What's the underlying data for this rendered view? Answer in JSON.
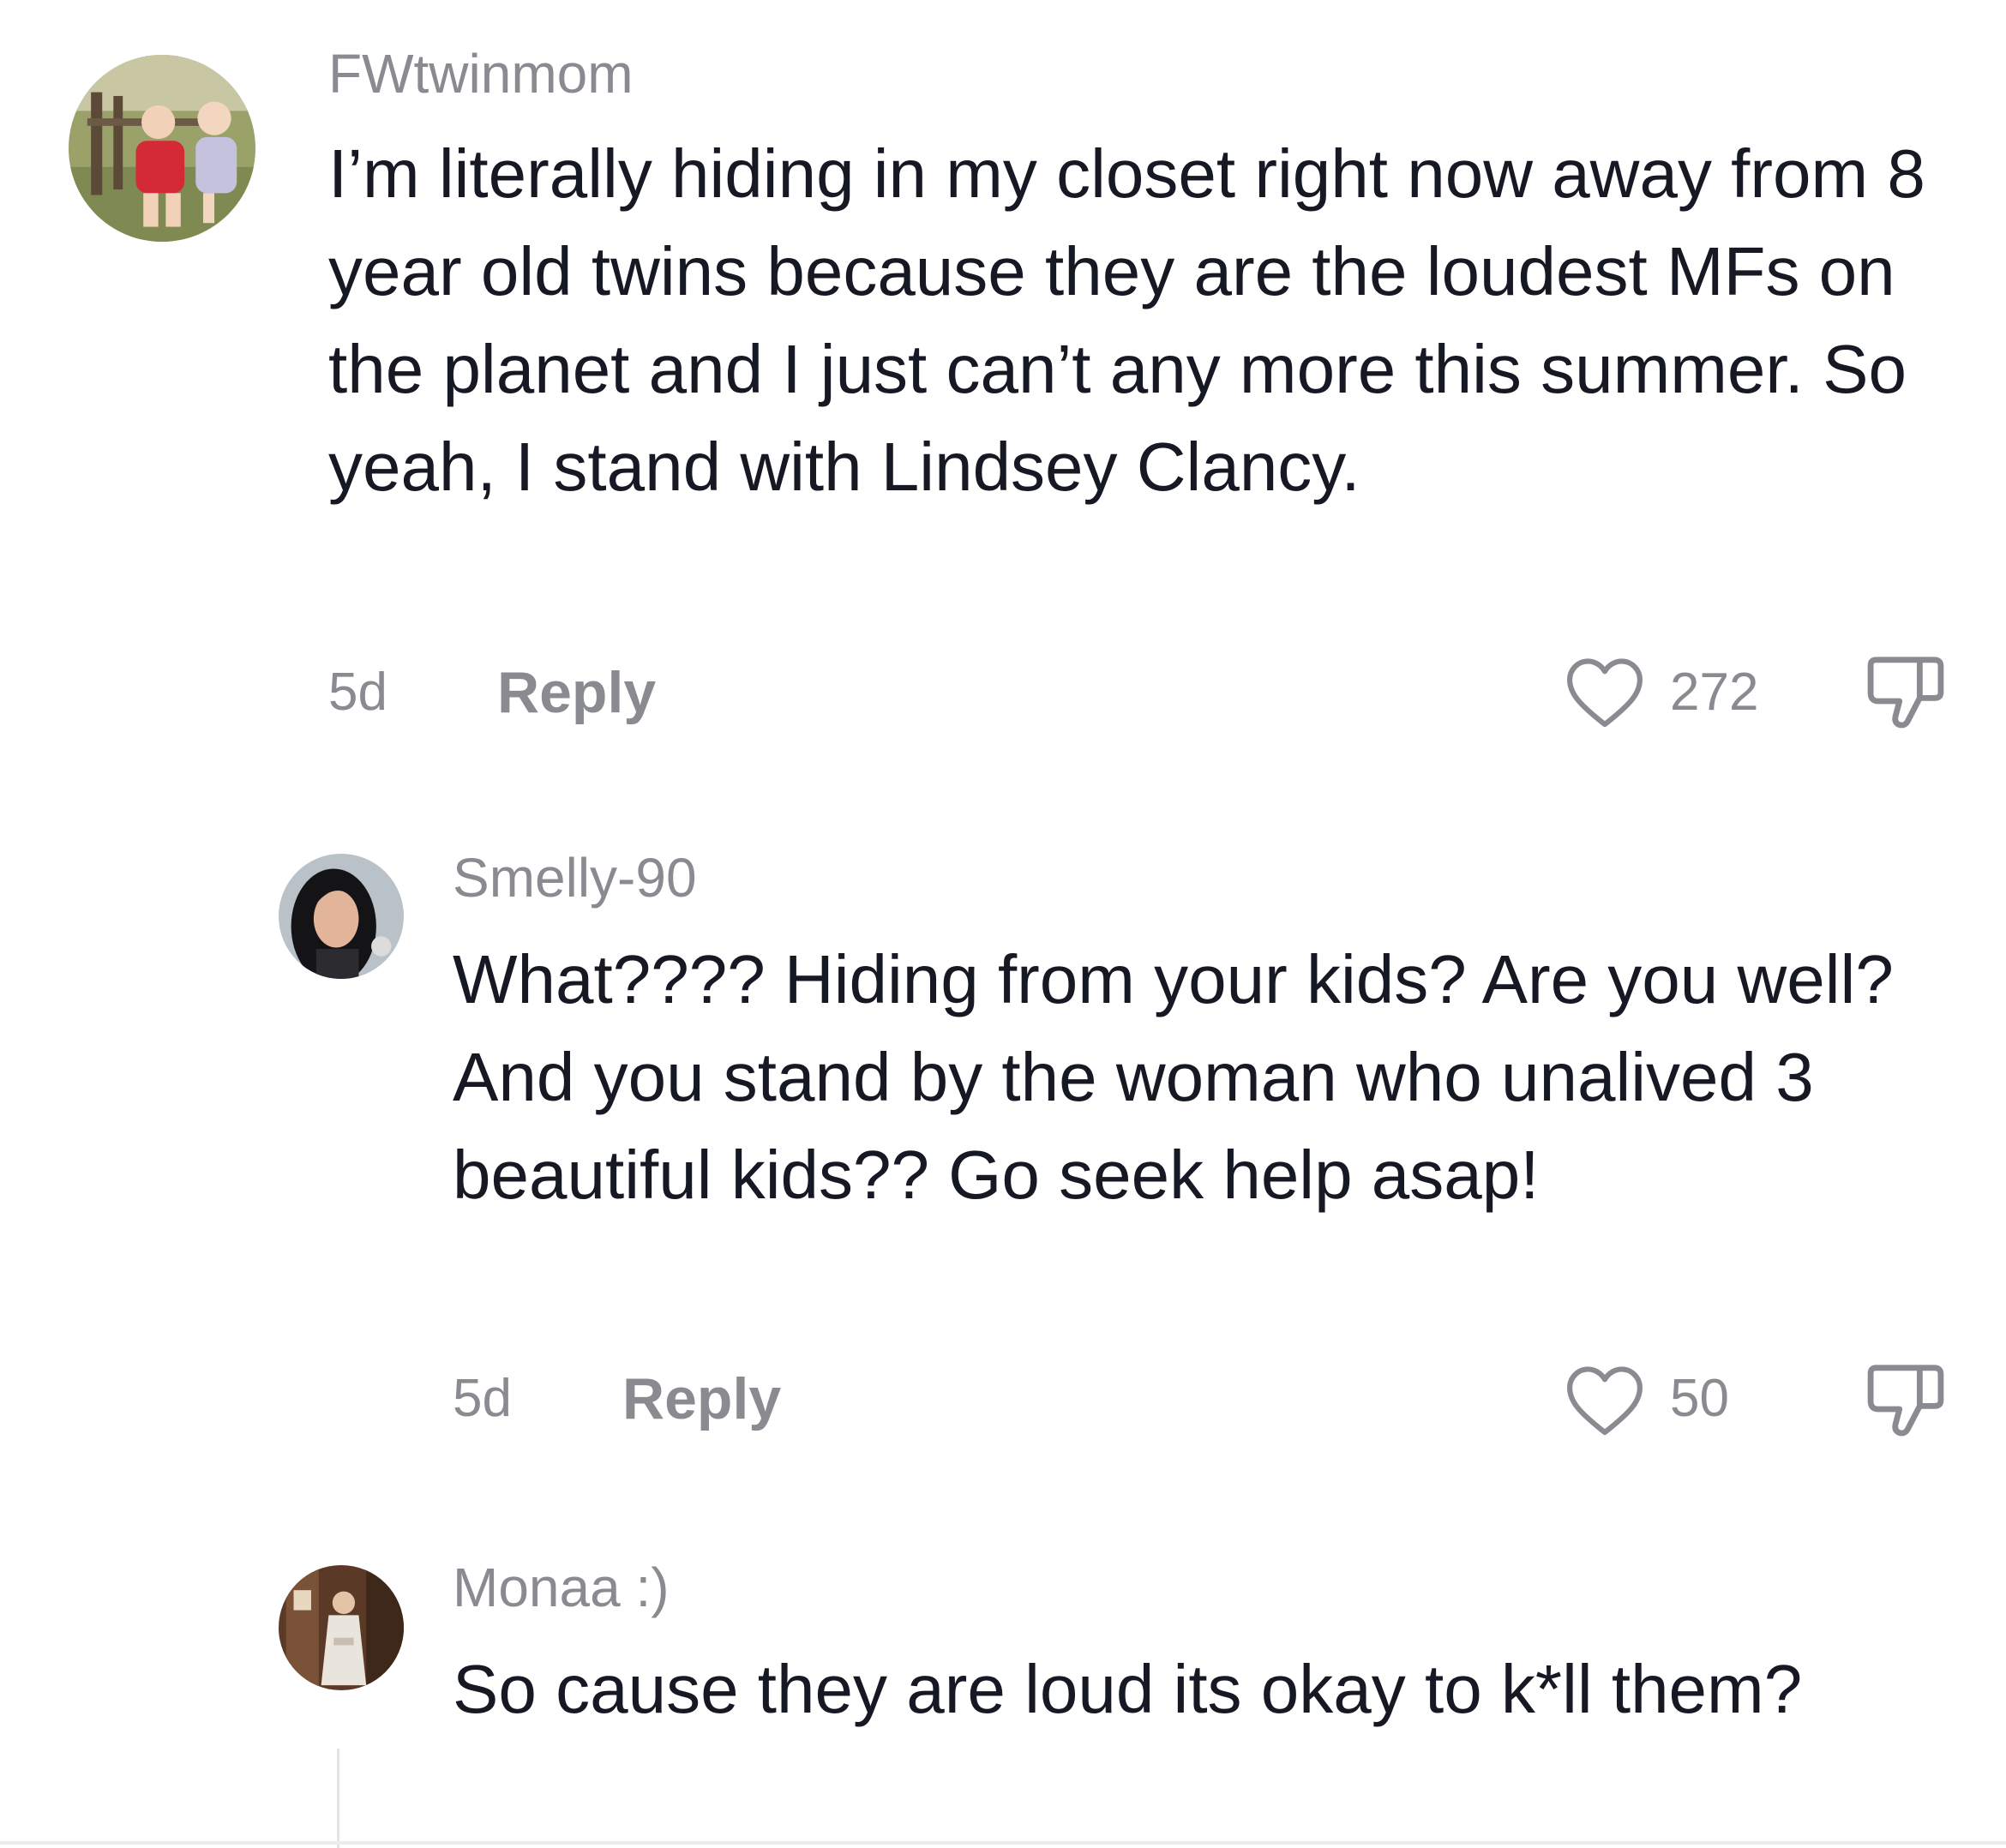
{
  "comments": [
    {
      "username": "FWtwinmom",
      "text": "I’m literally hiding in my closet right now away from 8 year old twins because they are the loudest MFs on the planet and I just can’t any more this summer. So yeah, I stand with Lindsey Clancy.",
      "time": "5d",
      "reply_label": "Reply",
      "likes": "272"
    },
    {
      "username": "Smelly-90",
      "text": "What???? Hiding from your kids? Are you well? And you stand by the woman who unalived 3 beautiful kids?? Go seek help asap!",
      "time": "5d",
      "reply_label": "Reply",
      "likes": "50"
    },
    {
      "username": "Monaa :)",
      "text": "So cause they are loud its okay to k*ll them?"
    }
  ],
  "colors": {
    "text": "#161823",
    "muted": "#8a8b91",
    "icon_stroke": "#8a8b91"
  },
  "icons": {
    "like": "heart-outline-icon",
    "dislike": "thumbs-down-outline-icon"
  }
}
